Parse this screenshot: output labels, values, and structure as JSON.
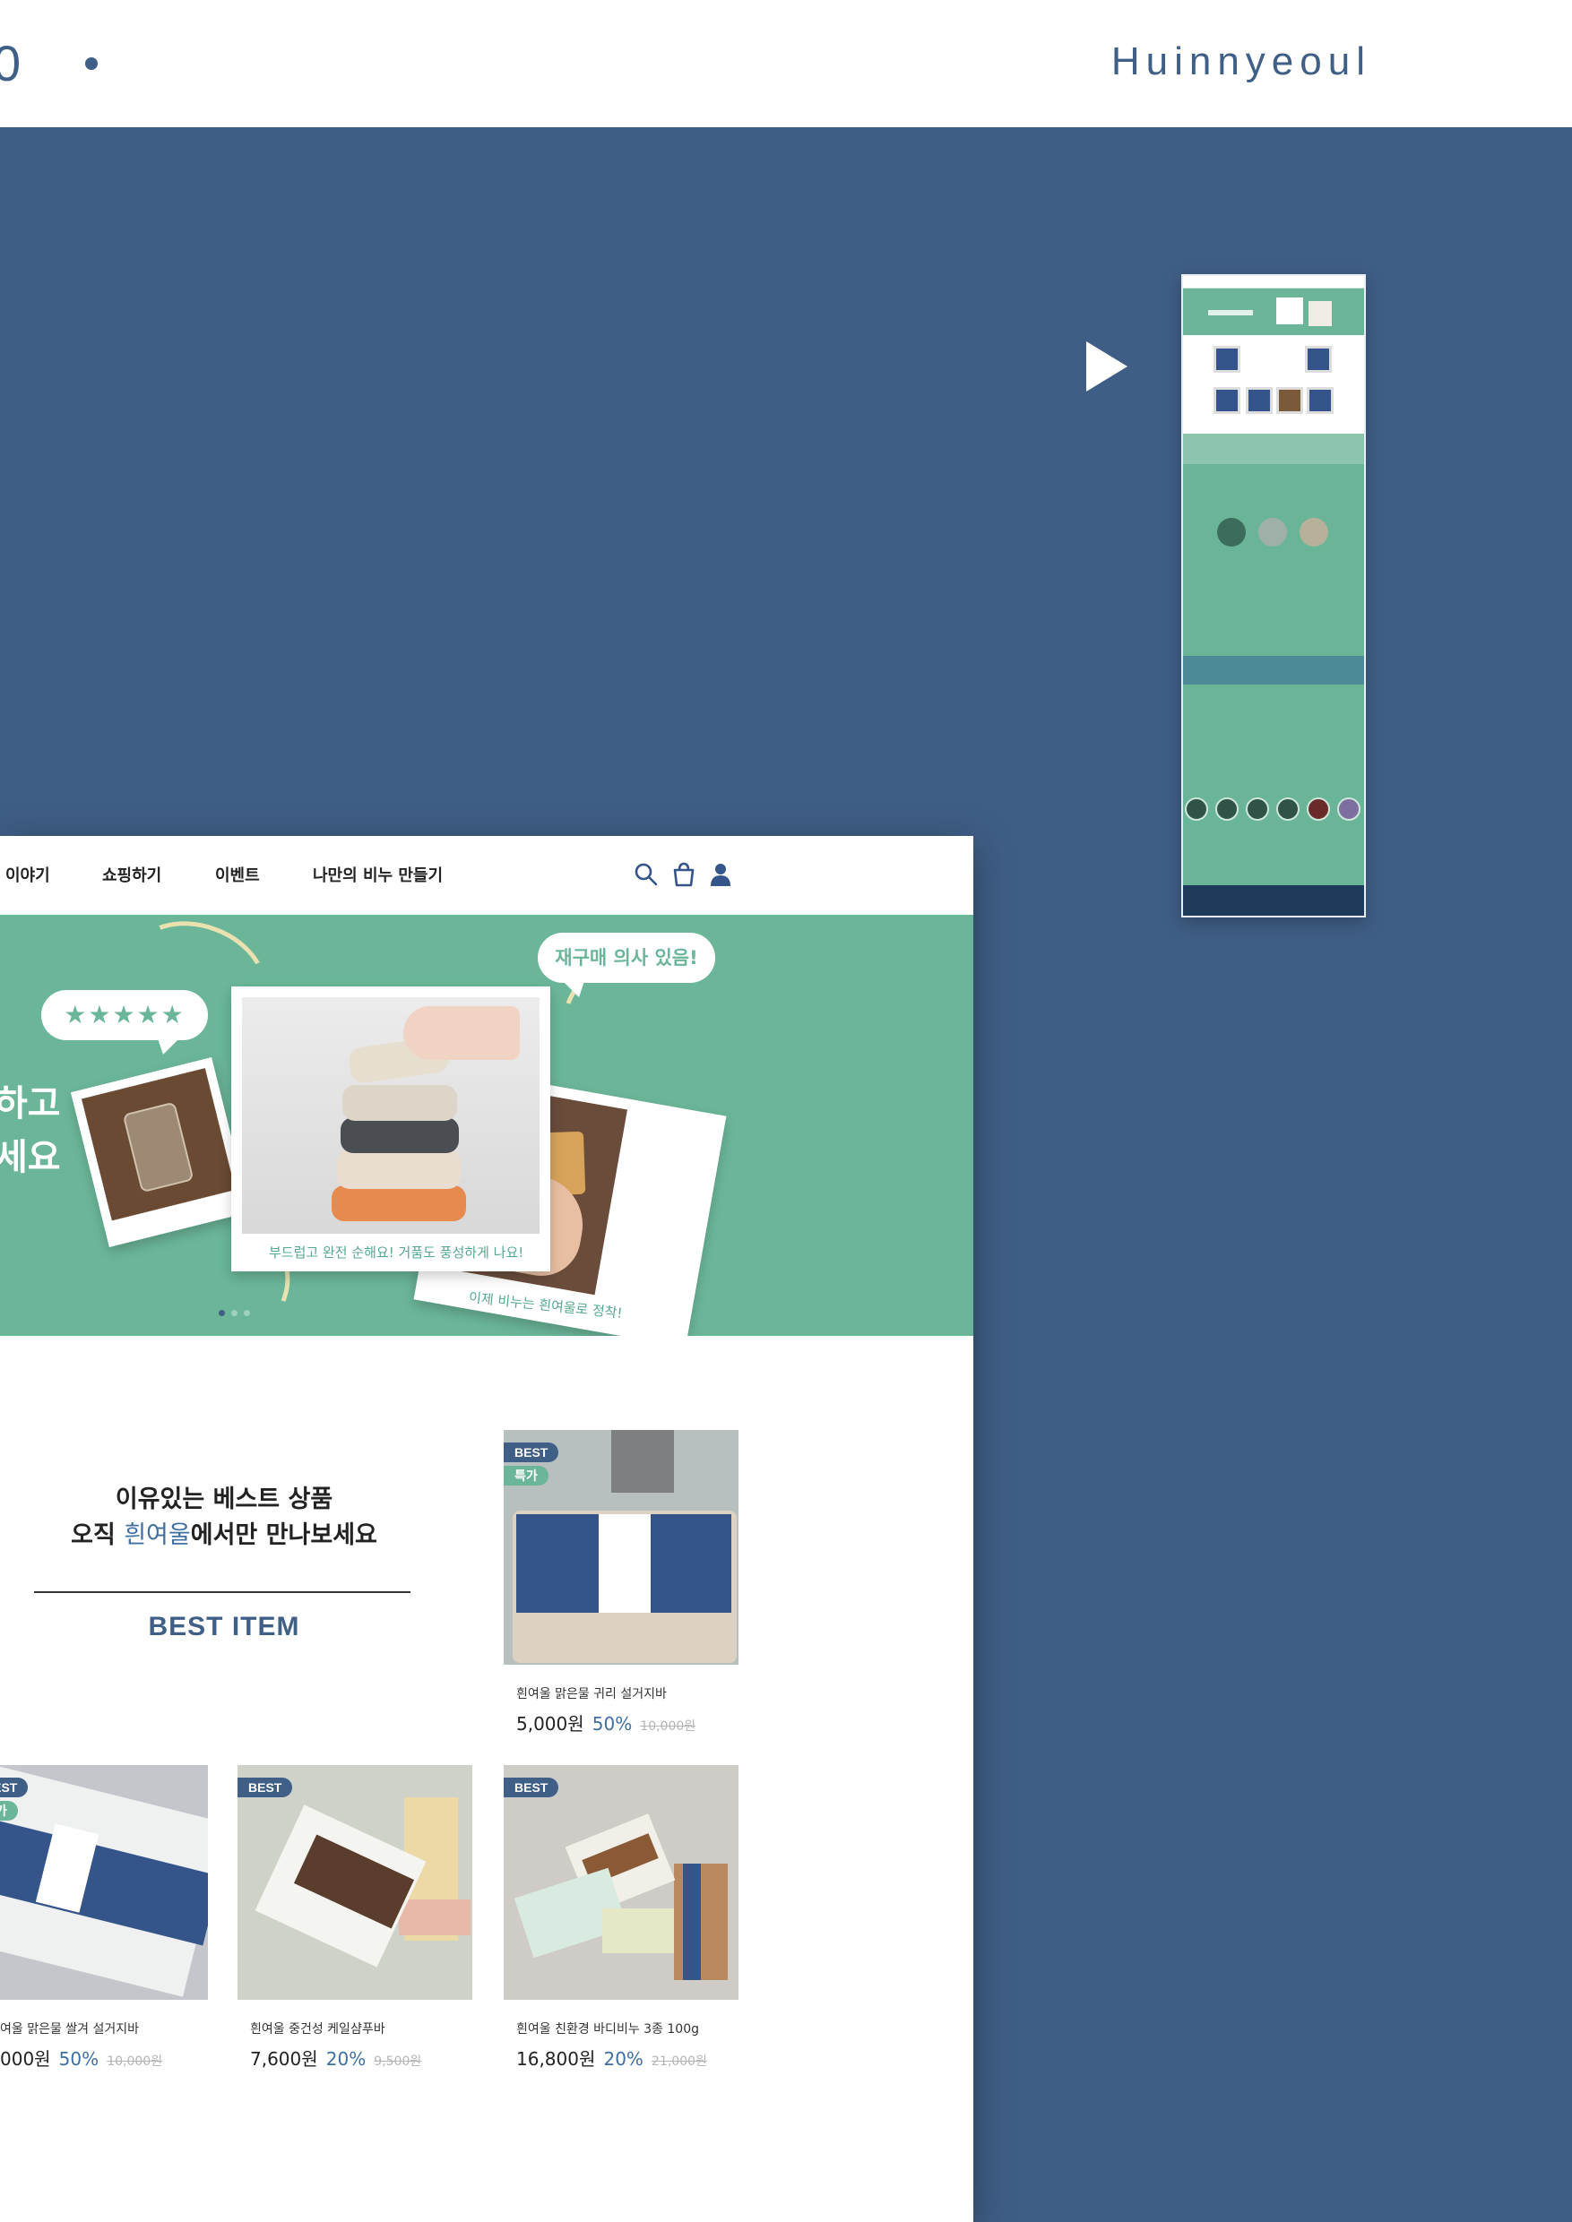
{
  "header": {
    "page_number": "0",
    "brand": "Huinnyeoul"
  },
  "site": {
    "nav": [
      "이야기",
      "쇼핑하기",
      "이벤트",
      "나만의 비누 만들기"
    ],
    "icons": [
      "search-icon",
      "shopping-bag-icon",
      "user-icon"
    ],
    "hero": {
      "text_lines": [
        "하고",
        "세요"
      ],
      "stars": "★★★★★",
      "speech_bubble": "재구매 의사 있음!",
      "center_caption": "부드럽고 완전 순해요! 거품도 풍성하게 나요!",
      "right_caption": "이제 비누는 흰여울로 정착!"
    },
    "best": {
      "title_line1": "이유있는 베스트 상품",
      "title_line2_prefix": "오직 ",
      "title_line2_brand": "흰여울",
      "title_line2_suffix": "에서만 만나보세요",
      "label": "BEST ITEM",
      "badge_best": "BEST",
      "badge_sale": "특가",
      "products": [
        {
          "name": "흰여울 맑은물 귀리 설거지바",
          "price": "5,000원",
          "discount": "50%",
          "original": "10,000원"
        },
        {
          "name": "여울 맑은물 쌀겨 설거지바",
          "price": "000원",
          "discount": "50%",
          "original": "10,000원"
        },
        {
          "name": "흰여울 중건성 케일샴푸바",
          "price": "7,600원",
          "discount": "20%",
          "original": "9,500원"
        },
        {
          "name": "흰여울 친환경 바디비누 3종 100g",
          "price": "16,800원",
          "discount": "20%",
          "original": "21,000원"
        }
      ]
    }
  },
  "colors": {
    "navy": "#3f5e86",
    "mint": "#6bb699",
    "white": "#ffffff"
  }
}
